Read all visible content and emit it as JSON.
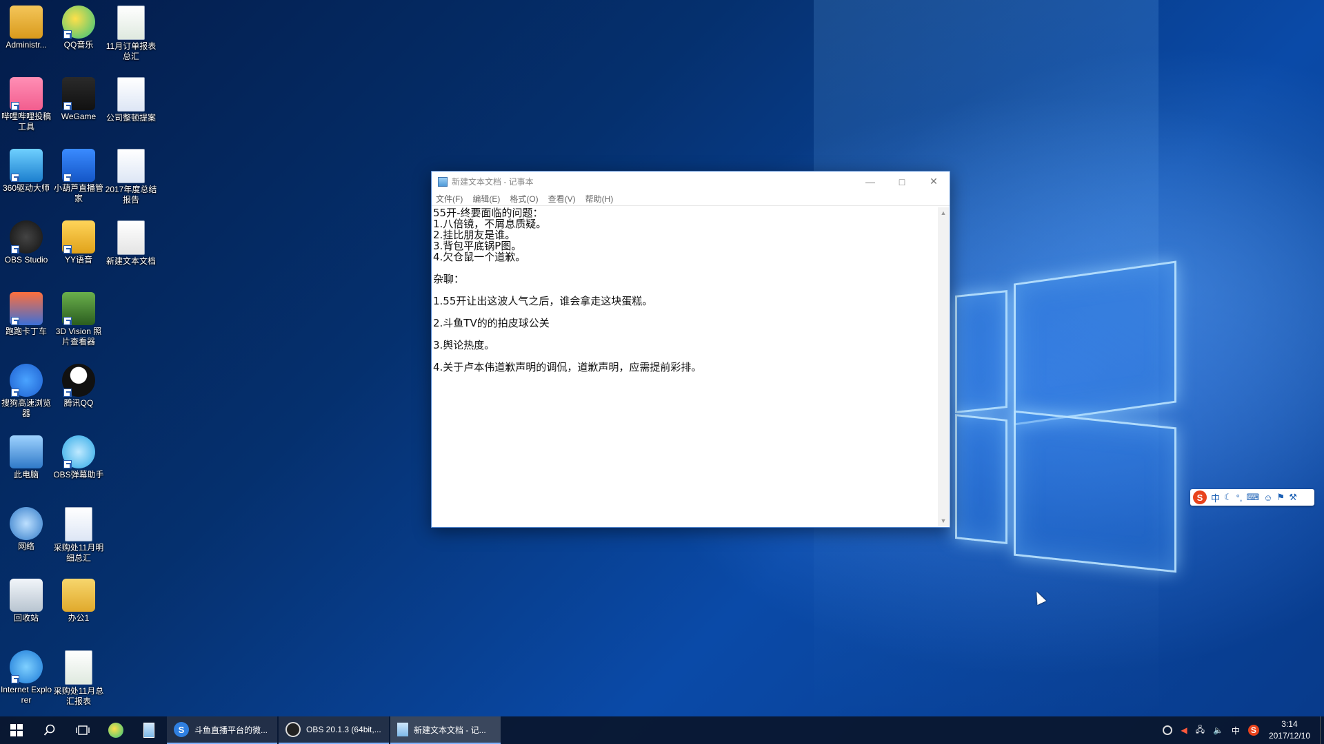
{
  "desktop": {
    "icons": [
      {
        "label": "Administr...",
        "icon": "user-folder-icon"
      },
      {
        "label": "QQ音乐",
        "icon": "qq-music-icon"
      },
      {
        "label": "11月订单报表总汇",
        "icon": "excel-file-icon"
      },
      {
        "label": "哔哩哔哩投稿工具",
        "icon": "bilibili-icon"
      },
      {
        "label": "WeGame",
        "icon": "wegame-icon"
      },
      {
        "label": "公司整顿提案",
        "icon": "word-file-icon"
      },
      {
        "label": "360驱动大师",
        "icon": "driver-master-icon"
      },
      {
        "label": "小葫芦直播管家",
        "icon": "live-helper-icon"
      },
      {
        "label": "2017年度总结报告",
        "icon": "word-file-icon"
      },
      {
        "label": "OBS Studio",
        "icon": "obs-icon"
      },
      {
        "label": "YY语音",
        "icon": "yy-voice-icon"
      },
      {
        "label": "新建文本文档",
        "icon": "text-file-icon"
      },
      {
        "label": "跑跑卡丁车",
        "icon": "kart-game-icon"
      },
      {
        "label": "3D Vision 照片查看器",
        "icon": "photo-viewer-icon"
      },
      {
        "label": "搜狗高速浏览器",
        "icon": "sogou-browser-icon"
      },
      {
        "label": "腾讯QQ",
        "icon": "qq-penguin-icon"
      },
      {
        "label": "此电脑",
        "icon": "computer-icon"
      },
      {
        "label": "OBS弹幕助手",
        "icon": "danmaku-helper-icon"
      },
      {
        "label": "网络",
        "icon": "network-icon"
      },
      {
        "label": "采购处11月明细总汇",
        "icon": "word-file-icon"
      },
      {
        "label": "回收站",
        "icon": "recycle-bin-icon"
      },
      {
        "label": "办公1",
        "icon": "folder-icon"
      },
      {
        "label": "Internet Explorer",
        "icon": "ie-icon"
      },
      {
        "label": "采购处11月总汇报表",
        "icon": "excel-file-icon"
      }
    ]
  },
  "notepad": {
    "title": "新建文本文档 - 记事本",
    "menu": [
      "文件(F)",
      "编辑(E)",
      "格式(O)",
      "查看(V)",
      "帮助(H)"
    ],
    "lines": [
      "55开-终要面临的问题：",
      "1.八倍镜，不屑息质疑。",
      "2.挂比朋友是谁。",
      "3.背包平底锅P图。",
      "4.欠仓鼠一个道歉。",
      "",
      "杂聊：",
      "",
      "1.55开让出这波人气之后，谁会拿走这块蛋糕。",
      "",
      "2.斗鱼TV的的拍皮球公关",
      "",
      "3.舆论热度。",
      "",
      "4.关于卢本伟道歉声明的调侃，道歉声明，应需提前彩排。"
    ]
  },
  "ime": {
    "logo": "S",
    "mode": "中",
    "items": [
      "moon-icon",
      "punctuation-icon",
      "keyboard-icon",
      "user-icon",
      "skin-icon",
      "settings-icon"
    ]
  },
  "taskbar": {
    "tasks": [
      {
        "label": "斗鱼直播平台的微...",
        "icon": "sogou-browser-icon"
      },
      {
        "label": "OBS 20.1.3 (64bit,...",
        "icon": "obs-icon"
      },
      {
        "label": "新建文本文档 - 记...",
        "icon": "notepad-icon"
      }
    ],
    "tray_lang": "中",
    "time": "3:14",
    "date": "2017/12/10"
  }
}
